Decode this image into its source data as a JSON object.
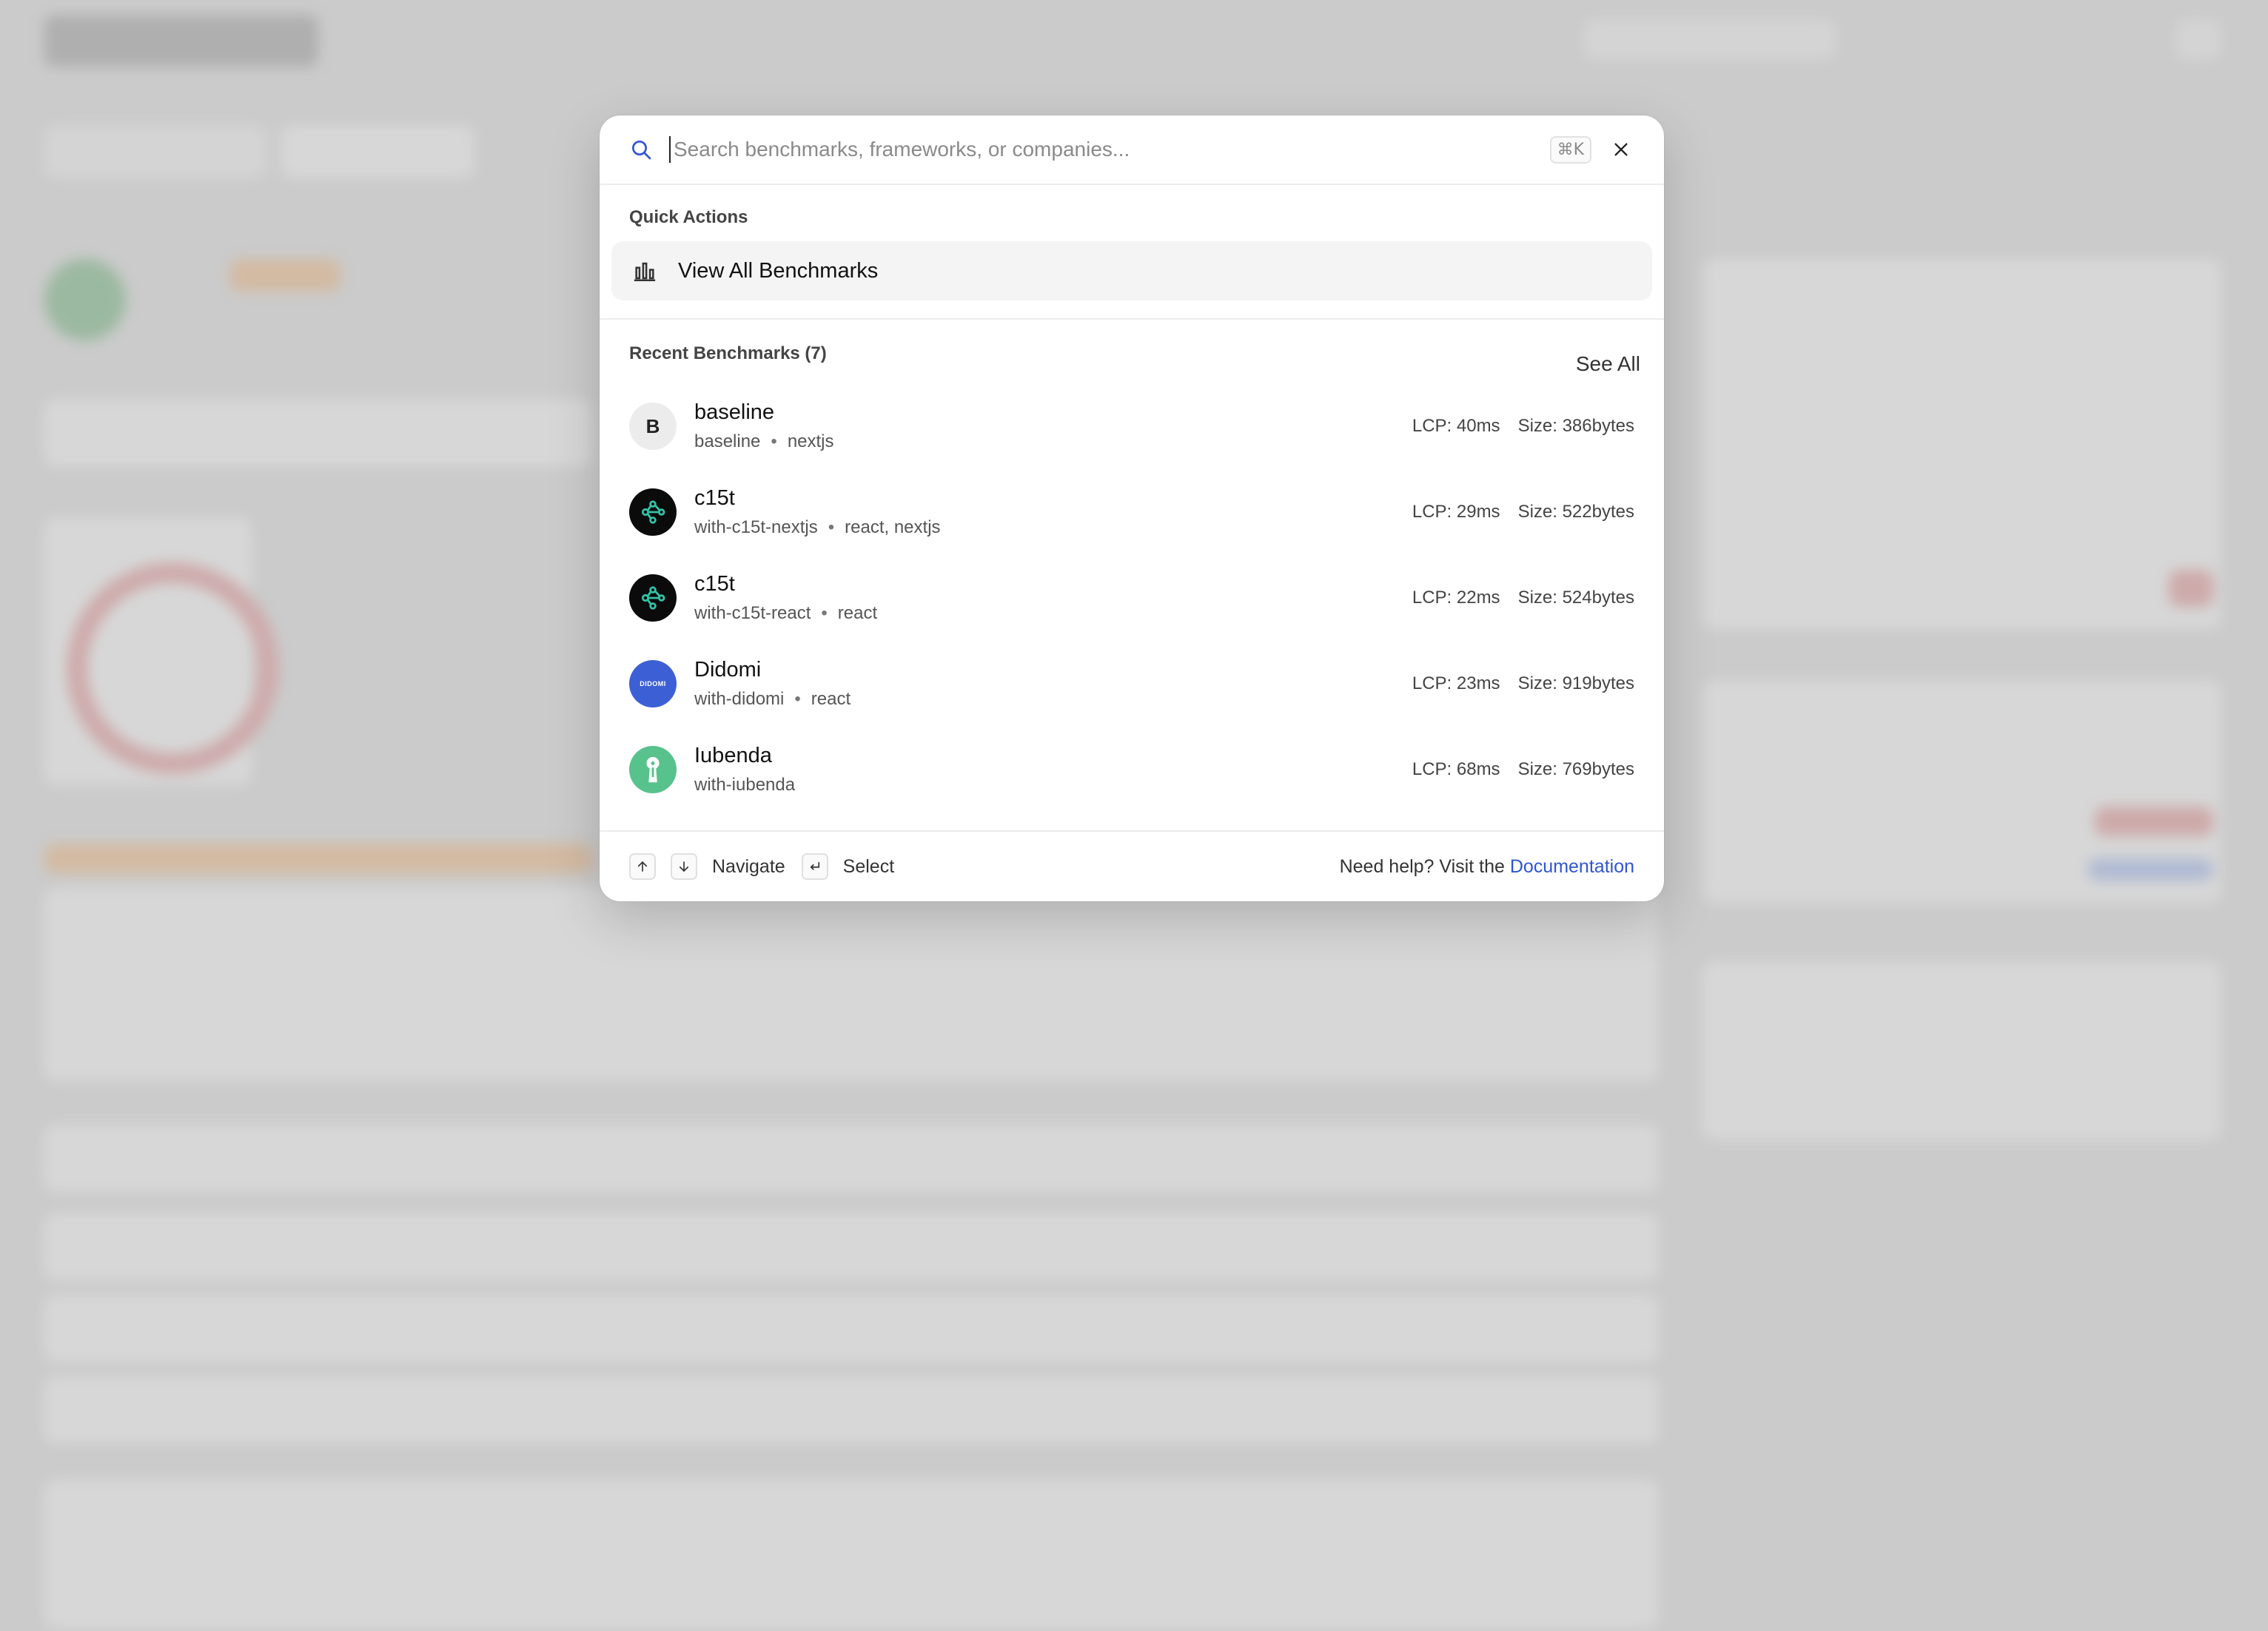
{
  "search": {
    "placeholder": "Search benchmarks, frameworks, or companies...",
    "shortcut": "⌘K"
  },
  "quick_actions": {
    "title": "Quick Actions",
    "items": [
      {
        "label": "View All Benchmarks",
        "icon": "bar-chart-icon"
      }
    ]
  },
  "recent": {
    "title": "Recent Benchmarks (7)",
    "see_all": "See All",
    "items": [
      {
        "name": "baseline",
        "avatar_text": "B",
        "slug": "baseline",
        "frameworks": "nextjs",
        "lcp": "LCP: 40ms",
        "size": "Size: 386bytes",
        "icon": "letter-avatar"
      },
      {
        "name": "c15t",
        "slug": "with-c15t-nextjs",
        "frameworks": "react, nextjs",
        "lcp": "LCP: 29ms",
        "size": "Size: 522bytes",
        "icon": "c15t-logo-icon"
      },
      {
        "name": "c15t",
        "slug": "with-c15t-react",
        "frameworks": "react",
        "lcp": "LCP: 22ms",
        "size": "Size: 524bytes",
        "icon": "c15t-logo-icon"
      },
      {
        "name": "Didomi",
        "avatar_text": "DIDOMI",
        "slug": "with-didomi",
        "frameworks": "react",
        "lcp": "LCP: 23ms",
        "size": "Size: 919bytes",
        "icon": "didomi-logo-icon"
      },
      {
        "name": "Iubenda",
        "slug": "with-iubenda",
        "frameworks": "",
        "lcp": "LCP: 68ms",
        "size": "Size: 769bytes",
        "icon": "iubenda-logo-icon"
      }
    ]
  },
  "footer": {
    "navigate": "Navigate",
    "select": "Select",
    "help_text": "Need help? Visit the",
    "help_link": "Documentation"
  },
  "colors": {
    "accent": "#2f55d4",
    "didomi": "#3d5fd6",
    "iubenda": "#58c28c",
    "c15t_bg": "#0b0b0b",
    "c15t_fg": "#33c2a6"
  }
}
